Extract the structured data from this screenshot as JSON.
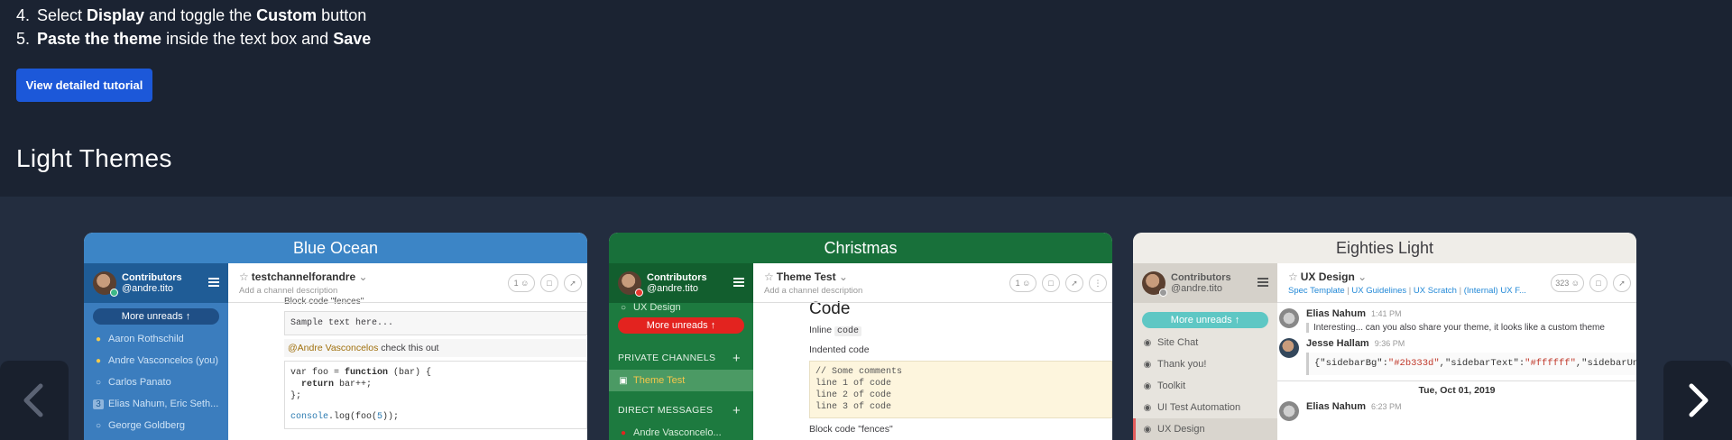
{
  "steps": [
    {
      "num": "4.",
      "a": "Select ",
      "b1": "Display",
      "c": " and toggle the ",
      "b2": "Custom",
      "d": " button"
    },
    {
      "num": "5.",
      "b1": "Paste the theme",
      "c": " inside the text box and ",
      "b2": "Save"
    }
  ],
  "tutorial_button": "View detailed tutorial",
  "section_title": "Light Themes",
  "colors": {
    "page_bg": "#1b2332",
    "carousel_bg": "#232d3f",
    "button": "#1c58d9",
    "blue_ocean": "#3c85c6",
    "christmas": "#18703a",
    "eighties": "#efede8"
  },
  "icons": {
    "prev": "chevron-left-icon",
    "next": "chevron-right-icon"
  },
  "cards": {
    "blue": {
      "title": "Blue Ocean",
      "team": "Contributors",
      "user": "@andre.tito",
      "pill": "More unreads ↑",
      "items": [
        "Aaron Rothschild",
        "Andre Vasconcelos (you)",
        "Carlos Panato",
        "Elias Nahum, Eric Seth...",
        "George Goldberg"
      ],
      "dm_count": "3",
      "channel": "testchannelforandre",
      "desc": "Add a channel description",
      "members": "1",
      "block_label": "Block code \"fences\"",
      "sample": "Sample text here...",
      "mention": "@Andre Vasconcelos",
      "mention_rest": " check this out",
      "code1a": "var foo = ",
      "code1b": "function",
      "code1c": " (bar) {",
      "code2a": "  ",
      "code2b": "return",
      "code2c": " bar++;",
      "code3": "};",
      "code4a": "console",
      "code4b": ".log(foo(",
      "code4c": "5",
      "code4d": "));"
    },
    "xmas": {
      "title": "Christmas",
      "team": "Contributors",
      "user": "@andre.tito",
      "top_item": "UX Design",
      "pill": "More unreads ↑",
      "private": "PRIVATE CHANNELS",
      "theme_item": "Theme Test",
      "direct": "DIRECT MESSAGES",
      "dm_item": "Andre Vasconcelo...",
      "channel": "Theme Test",
      "desc": "Add a channel description",
      "members": "1",
      "h_code": "Code",
      "inline_a": "Inline ",
      "inline_b": "code",
      "indented": "Indented code",
      "c1": "// Some comments",
      "c2": "line 1 of code",
      "c3": "line 2 of code",
      "c4": "line 3 of code",
      "fences": "Block code \"fences\""
    },
    "eighties": {
      "title": "Eighties Light",
      "team": "Contributors",
      "user": "@andre.tito",
      "pill": "More unreads ↑",
      "items": [
        "Site Chat",
        "Thank you!",
        "Toolkit",
        "UI Test Automation",
        "UX Design"
      ],
      "channel": "UX Design",
      "links": [
        "Spec Template",
        "UX Guidelines",
        "UX Scratch",
        "(Internal) UX F..."
      ],
      "members": "323",
      "m1_user": "Elias Nahum",
      "m1_time": "1:41 PM",
      "m1_text": "Interesting... can you also share your theme, it looks like a custom theme",
      "m2_user": "Jesse Hallam",
      "m2_time": "9:36 PM",
      "m2_code_a": "{\"sidebarBg\":",
      "m2_code_b": "\"#2b333d\"",
      "m2_code_c": ",\"sidebarText\":",
      "m2_code_d": "\"#ffffff\"",
      "m2_code_e": ",\"sidebarUn",
      "date": "Tue, Oct 01, 2019",
      "m3_user": "Elias Nahum",
      "m3_time": "6:23 PM"
    }
  }
}
